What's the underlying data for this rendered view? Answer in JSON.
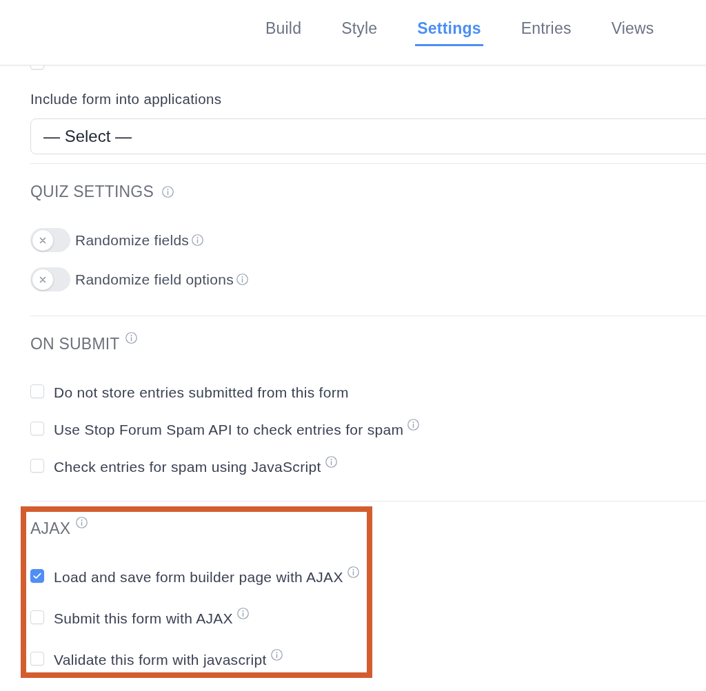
{
  "tabs": [
    {
      "label": "Build",
      "selected": false
    },
    {
      "label": "Style",
      "selected": false
    },
    {
      "label": "Settings",
      "selected": true
    },
    {
      "label": "Entries",
      "selected": false
    },
    {
      "label": "Views",
      "selected": false
    }
  ],
  "sections": [
    {
      "highlighted": false,
      "items": [
        {
          "kind": "checkbox",
          "checked": false
        },
        {
          "kind": "select",
          "label": "Include form into applications",
          "value": "— Select —"
        }
      ]
    },
    {
      "title": "QUIZ SETTINGS",
      "info": true,
      "highlighted": false,
      "items": [
        {
          "kind": "toggle",
          "label": "Randomize fields",
          "on": false,
          "info": true
        },
        {
          "kind": "toggle",
          "label": "Randomize field options",
          "on": false,
          "info": true
        }
      ]
    },
    {
      "title": "ON SUBMIT",
      "info": true,
      "highlighted": false,
      "items": [
        {
          "kind": "checkbox",
          "label": "Do not store entries submitted from this form",
          "checked": false,
          "info": false
        },
        {
          "kind": "checkbox",
          "label": "Use Stop Forum Spam API to check entries for spam",
          "checked": false,
          "info": true
        },
        {
          "kind": "checkbox",
          "label": "Check entries for spam using JavaScript",
          "checked": false,
          "info": true
        }
      ]
    },
    {
      "title": "AJAX",
      "info": true,
      "highlighted": true,
      "items": [
        {
          "kind": "checkbox",
          "label": "Load and save form builder page with AJAX",
          "checked": true,
          "info": true
        },
        {
          "kind": "checkbox",
          "label": "Submit this form with AJAX",
          "checked": false,
          "info": true
        },
        {
          "kind": "checkbox",
          "label": "Validate this form with javascript",
          "checked": false,
          "info": true
        }
      ]
    }
  ]
}
